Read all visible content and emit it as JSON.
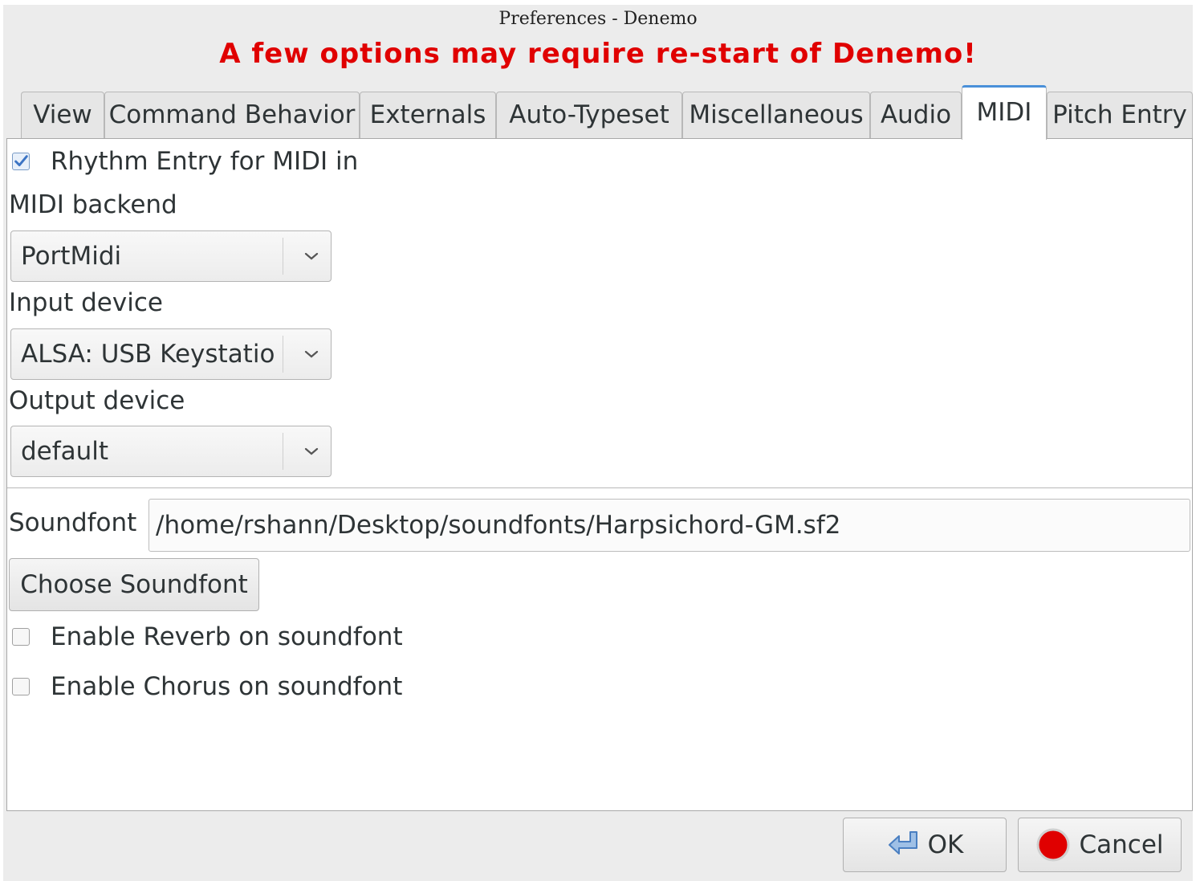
{
  "window": {
    "title": "Preferences - Denemo",
    "warning": "A few options may require re-start of Denemo!"
  },
  "tabs": [
    {
      "label": "View",
      "active": false
    },
    {
      "label": "Command Behavior",
      "active": false
    },
    {
      "label": "Externals",
      "active": false
    },
    {
      "label": "Auto-Typeset",
      "active": false
    },
    {
      "label": "Miscellaneous",
      "active": false
    },
    {
      "label": "Audio",
      "active": false
    },
    {
      "label": "MIDI",
      "active": true
    },
    {
      "label": "Pitch Entry",
      "active": false
    }
  ],
  "midi": {
    "rhythm_entry": {
      "label": "Rhythm Entry for MIDI in",
      "checked": true
    },
    "backend": {
      "label": "MIDI backend",
      "value": "PortMidi"
    },
    "input_device": {
      "label": "Input device",
      "value": "ALSA: USB Keystatio"
    },
    "output_device": {
      "label": "Output device",
      "value": "default"
    },
    "soundfont": {
      "label": "Soundfont",
      "value": "/home/rshann/Desktop/soundfonts/Harpsichord-GM.sf2"
    },
    "choose_soundfont": "Choose Soundfont",
    "reverb": {
      "label": "Enable Reverb on soundfont",
      "checked": false
    },
    "chorus": {
      "label": "Enable Chorus on soundfont",
      "checked": false
    }
  },
  "dialog_buttons": {
    "ok": "OK",
    "cancel": "Cancel"
  },
  "colors": {
    "warning": "#e00000",
    "active_tab_accent": "#4a90d9",
    "cancel_icon": "#e00000",
    "ok_icon": "#4a7fc1"
  },
  "icons": [
    "checkmark-icon",
    "chevron-down-icon",
    "ok-icon",
    "stop-icon"
  ]
}
